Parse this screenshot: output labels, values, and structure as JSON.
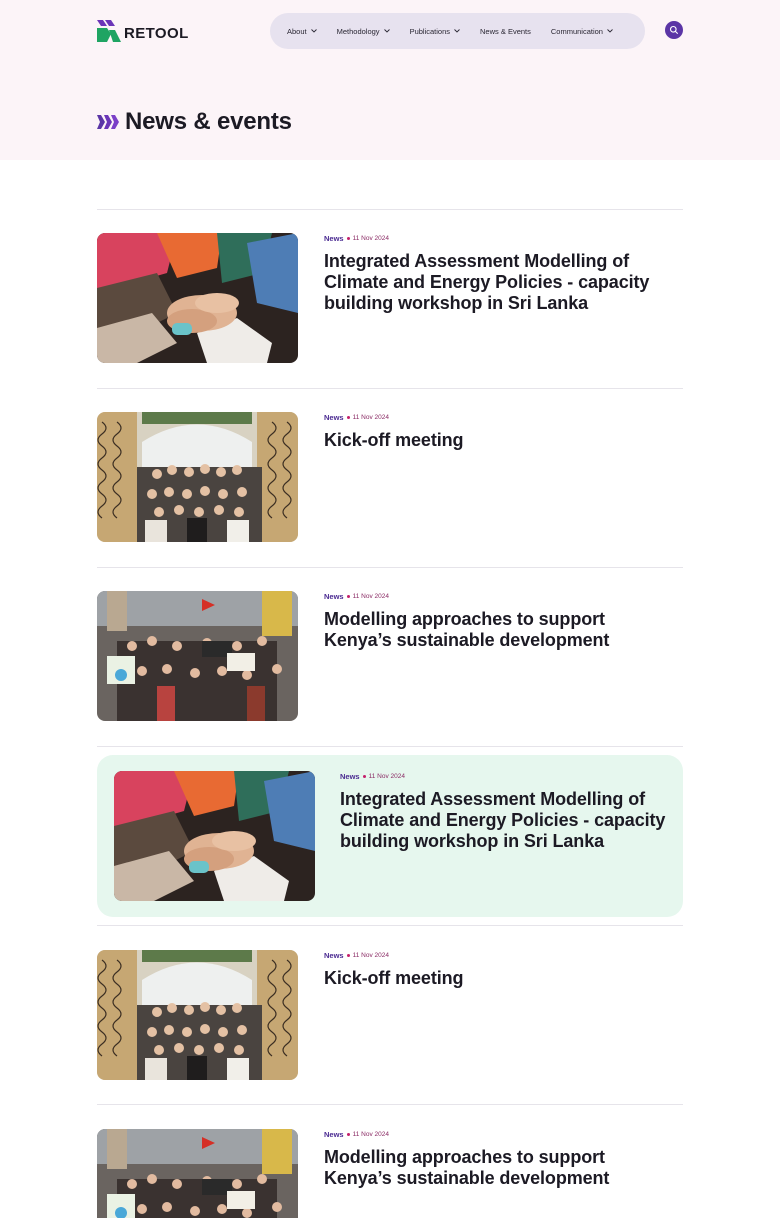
{
  "header": {
    "logo_text": "RETOOL",
    "nav": [
      {
        "label": "About",
        "has_dropdown": true
      },
      {
        "label": "Methodology",
        "has_dropdown": true
      },
      {
        "label": "Publications",
        "has_dropdown": true
      },
      {
        "label": "News & Events",
        "has_dropdown": false
      },
      {
        "label": "Communication",
        "has_dropdown": true
      }
    ],
    "search_icon": "search-icon"
  },
  "page": {
    "title": "News & events"
  },
  "colors": {
    "brand_purple": "#5b35a6",
    "brand_green": "#1fa463",
    "hero_background": "#fcf4f8",
    "highlight_card": "#e6f7ee",
    "date_dot": "#c4206a"
  },
  "articles": [
    {
      "type": "News",
      "date": "11 Nov 2024",
      "title": "Integrated Assessment Modelling of Climate and Energy Policies - capacity building workshop in Sri Lanka",
      "image": "hands-stacked",
      "highlighted": false
    },
    {
      "type": "News",
      "date": "11 Nov 2024",
      "title": "Kick-off meeting",
      "image": "group-photo",
      "highlighted": false
    },
    {
      "type": "News",
      "date": "11 Nov 2024",
      "title": "Modelling approaches to support Kenya’s sustainable development",
      "image": "climate-march",
      "highlighted": false
    },
    {
      "type": "News",
      "date": "11 Nov 2024",
      "title": "Integrated Assessment Modelling of Climate and Energy Policies - capacity building workshop in Sri Lanka",
      "image": "hands-stacked",
      "highlighted": true
    },
    {
      "type": "News",
      "date": "11 Nov 2024",
      "title": "Kick-off meeting",
      "image": "group-photo",
      "highlighted": false
    },
    {
      "type": "News",
      "date": "11 Nov 2024",
      "title": "Modelling approaches to support Kenya’s sustainable development",
      "image": "climate-march",
      "highlighted": false
    }
  ]
}
